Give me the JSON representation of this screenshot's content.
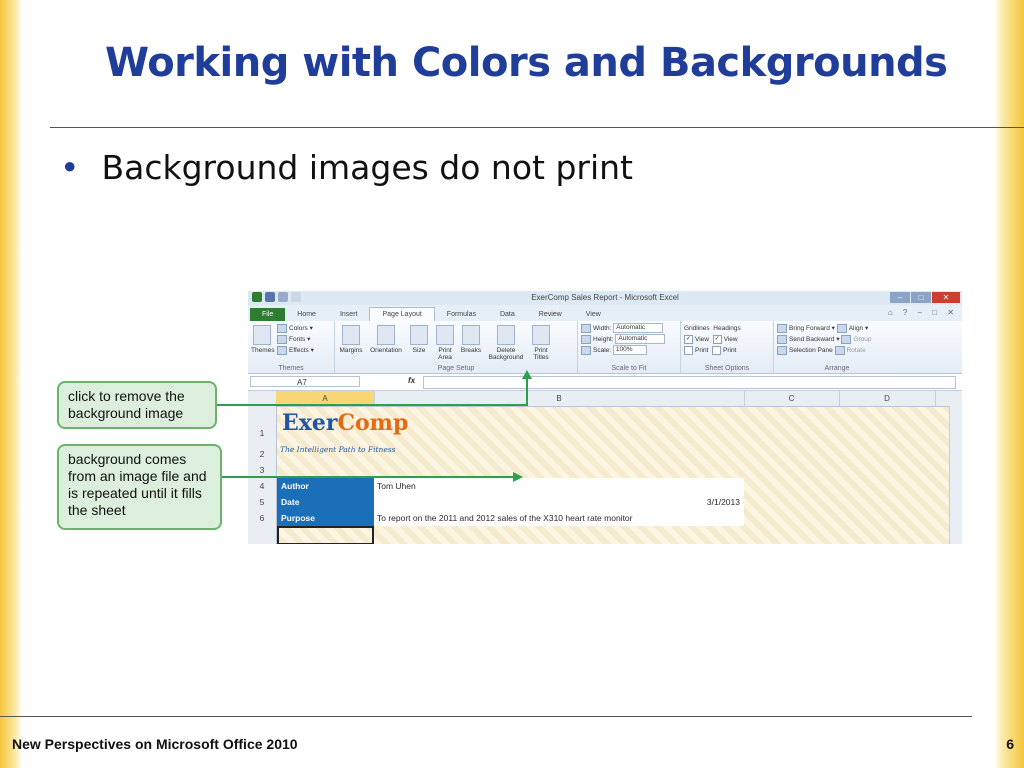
{
  "slide": {
    "title": "Working with Colors and Backgrounds",
    "bullet": "Background images do not print",
    "footer_left": "New Perspectives on Microsoft Office 2010",
    "page_number": "6"
  },
  "callouts": {
    "first": "click to remove the background image",
    "second": "background comes from an image file and is repeated until it fills the sheet"
  },
  "excel": {
    "window_title": "ExerComp Sales Report - Microsoft Excel",
    "tabs": [
      "File",
      "Home",
      "Insert",
      "Page Layout",
      "Formulas",
      "Data",
      "Review",
      "View"
    ],
    "active_tab": "Page Layout",
    "ribbon": {
      "themes": {
        "big": "Themes",
        "colors": "Colors",
        "fonts": "Fonts",
        "effects": "Effects",
        "label": "Themes"
      },
      "page_setup": {
        "margins": "Margins",
        "orientation": "Orientation",
        "size": "Size",
        "print_area": "Print Area",
        "breaks": "Breaks",
        "delete_background": "Delete Background",
        "print_titles": "Print Titles",
        "label": "Page Setup"
      },
      "scale": {
        "width_label": "Width:",
        "width_value": "Automatic",
        "height_label": "Height:",
        "height_value": "Automatic",
        "scale_label": "Scale:",
        "scale_value": "100%",
        "label": "Scale to Fit"
      },
      "sheet_options": {
        "gridlines": "Gridlines",
        "headings": "Headings",
        "view": "View",
        "print": "Print",
        "label": "Sheet Options"
      },
      "arrange": {
        "bring_forward": "Bring Forward",
        "send_backward": "Send Backward",
        "selection_pane": "Selection Pane",
        "align": "Align",
        "group": "Group",
        "rotate": "Rotate",
        "label": "Arrange"
      }
    },
    "name_box": "A7",
    "fx": "fx",
    "columns": [
      "A",
      "B",
      "C",
      "D"
    ],
    "rows": [
      "1",
      "2",
      "3",
      "4",
      "5",
      "6"
    ],
    "logo": {
      "part1": "Exer",
      "part2": "Comp"
    },
    "tagline": "The Intelligent Path to Fitness",
    "cells": {
      "a4": "Author",
      "b4": "Tom Uhen",
      "a5": "Date",
      "b5": "3/1/2013",
      "a6": "Purpose",
      "b6": "To report on the 2011 and 2012 sales of the X310 heart rate monitor"
    },
    "colors": {
      "file_tab": "#2f7d32",
      "header_cells": "#1a6fb8",
      "logo_blue": "#2055a5",
      "logo_orange": "#e46a13"
    }
  }
}
